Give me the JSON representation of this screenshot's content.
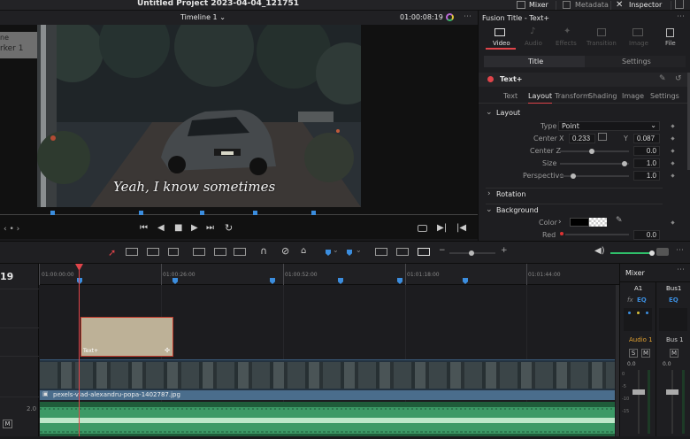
{
  "window": {
    "title": "Untitled Project 2023-04-04_121751"
  },
  "top_buttons": {
    "mixer": "Mixer",
    "metadata": "Metadata",
    "inspector": "Inspector"
  },
  "viewer": {
    "timeline_name": "Timeline 1",
    "timecode": "01:00:08:19",
    "overlay_lines": [
      "ne",
      "rker 1"
    ],
    "caption": "Yeah, I know sometimes"
  },
  "inspector": {
    "title": "Fusion Title - Text+",
    "tabs": [
      "Video",
      "Audio",
      "Effects",
      "Transition",
      "Image",
      "File"
    ],
    "subtabs": [
      "Title",
      "Settings"
    ],
    "tool_name": "Text+",
    "tool_tabs": [
      "Text",
      "Layout",
      "Transform",
      "Shading",
      "Image",
      "Settings"
    ],
    "section_layout": "Layout",
    "type_label": "Type",
    "type_value": "Point",
    "center_label": "Center",
    "x_label": "X",
    "x_value": "0.233",
    "y_label": "Y",
    "y_value": "0.087",
    "centerz_label": "Center Z",
    "centerz_value": "0.0",
    "size_label": "Size",
    "size_value": "1.0",
    "perspective_label": "Perspective",
    "perspective_value": "1.0",
    "section_rotation": "Rotation",
    "section_background": "Background",
    "color_label": "Color",
    "red_label": "Red",
    "red_value": "0.0",
    "colors": {
      "accent": "#e0444a",
      "active_tab": "#e6e6e6"
    }
  },
  "timeline": {
    "track_number": "19",
    "ruler": [
      "01:00:00:00",
      "01:00:26:00",
      "01:00:52:00",
      "01:01:18:00",
      "01:01:44:00"
    ],
    "title_clip": "Text+",
    "video_clip": "pexels-vlad-alexandru-popa-1402787.jpg",
    "audio_level": "2.0",
    "m_button": "M"
  },
  "mixer": {
    "title": "Mixer",
    "a1": "A1",
    "bus1": "Bus1",
    "eq": "EQ",
    "audio1": "Audio 1",
    "bus1b": "Bus 1",
    "s": "S",
    "m": "M",
    "zero": "0.0",
    "scale": [
      "0",
      "-5",
      "-10",
      "-15"
    ],
    "colors": {
      "audio": "#e0a030",
      "eq": "#3b8dde"
    }
  }
}
